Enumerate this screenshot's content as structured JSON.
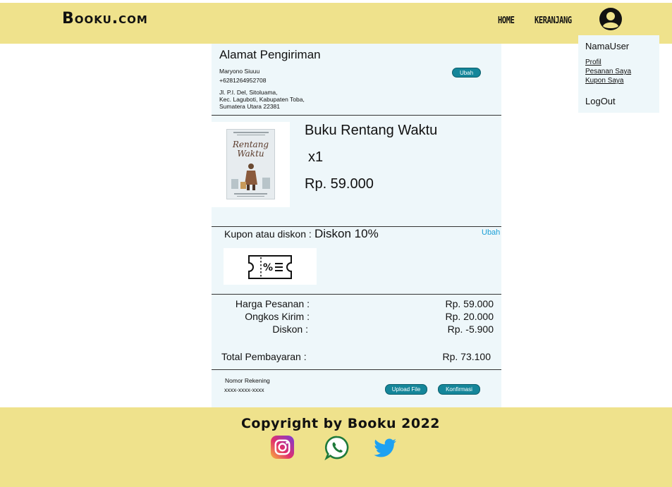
{
  "header": {
    "logo": "Booku.com",
    "nav_home": "HOME",
    "nav_cart": "KERANJANG"
  },
  "user_menu": {
    "name": "NamaUser",
    "profile": "Profil",
    "orders": "Pesanan Saya",
    "coupons": "Kupon Saya",
    "logout": "LogOut"
  },
  "address": {
    "title": "Alamat Pengiriman",
    "recipient": "Maryono Siuuu",
    "phone": "+6281264952708",
    "line1": "Jl. P.I. Del, Sitoluama,",
    "line2": "Kec. Laguboti, Kabupaten Toba,",
    "line3": "Sumatera Utara 22381",
    "edit_label": "Ubah"
  },
  "product": {
    "title": "Buku Rentang Waktu",
    "quantity": "x1",
    "price": "Rp. 59.000",
    "cover_title_1": "Rentang",
    "cover_title_2": "Waktu"
  },
  "coupon": {
    "label": "Kupon atau diskon :",
    "value": "Diskon 10%",
    "edit_label": "Ubah"
  },
  "summary": {
    "order_label": "Harga Pesanan :",
    "order_value": "Rp. 59.000",
    "shipping_label": "Ongkos Kirim :",
    "shipping_value": "Rp. 20.000",
    "discount_label": "Diskon :",
    "discount_value": "Rp. -5.900",
    "total_label": "Total Pembayaran :",
    "total_value": "Rp. 73.100"
  },
  "payment": {
    "account_label": "Nomor Rekening",
    "account_number": "xxxx-xxxx-xxxx",
    "upload_label": "Upload File",
    "confirm_label": "Konfirmasi"
  },
  "footer": {
    "copyright": "Copyright by Booku 2022"
  },
  "colors": {
    "header_bg": "#efe28c",
    "panel_bg": "#eef7fa",
    "button": "#15869a",
    "link": "#1a9fd6"
  }
}
